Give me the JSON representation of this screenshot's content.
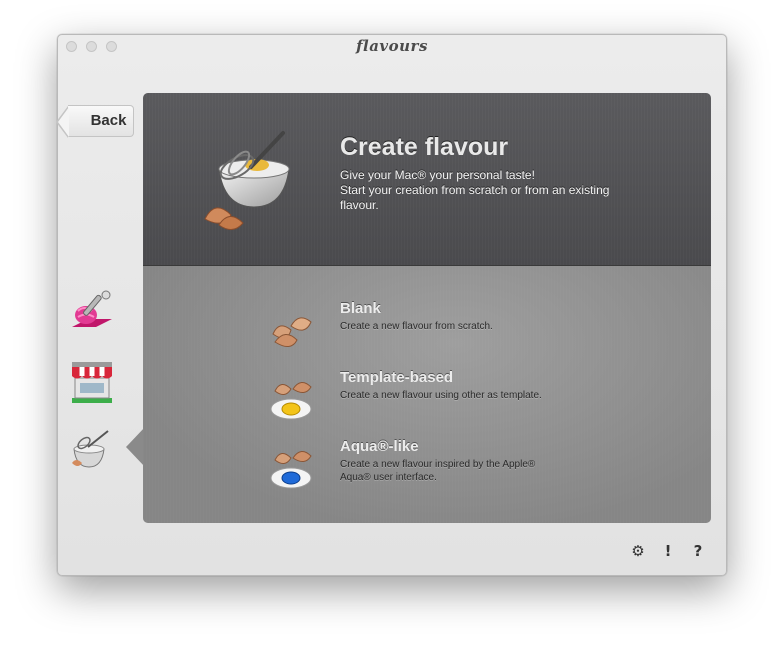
{
  "window": {
    "title": "flavours"
  },
  "nav": {
    "back_label": "Back"
  },
  "sidebar": {
    "items": [
      {
        "name": "flavour-editor",
        "icon": "paint-roller-icon"
      },
      {
        "name": "flavour-store",
        "icon": "storefront-icon"
      },
      {
        "name": "create-flavour",
        "icon": "mixing-bowl-icon",
        "selected": true
      }
    ]
  },
  "hero": {
    "title": "Create flavour",
    "line1": "Give your Mac® your personal taste!",
    "line2": "Start your creation from scratch or from an existing flavour."
  },
  "options": [
    {
      "title": "Blank",
      "desc": "Create a new flavour from scratch.",
      "icon": "cracked-egg-icon"
    },
    {
      "title": "Template-based",
      "desc": "Create a new flavour using other as template.",
      "icon": "yellow-egg-icon"
    },
    {
      "title": "Aqua®-like",
      "desc": "Create a new flavour inspired by the Apple® Aqua® user interface.",
      "icon": "blue-egg-icon"
    }
  ],
  "footer": {
    "settings_icon": "gear-icon",
    "alert_label": "!",
    "help_label": "?"
  },
  "colors": {
    "panel_top": "#505053",
    "panel_bottom": "#8f8f8f",
    "window_bg": "#e8e8e8"
  }
}
